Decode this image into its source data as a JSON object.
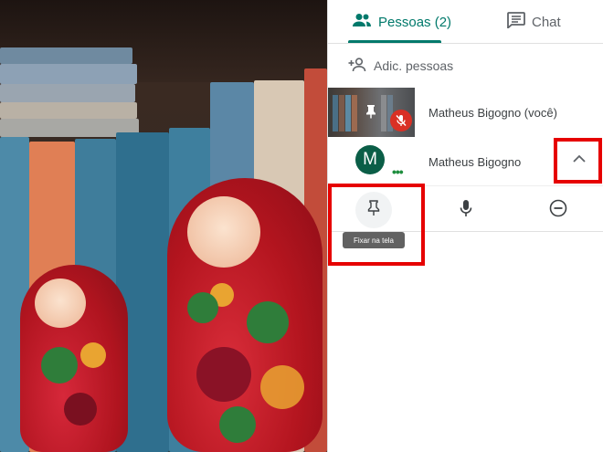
{
  "tabs": {
    "people_label": "Pessoas (2)",
    "chat_label": "Chat"
  },
  "add_people_label": "Adic. pessoas",
  "participants": [
    {
      "name": "Matheus Bigogno (você)",
      "muted": true
    },
    {
      "name": "Matheus Bigogno",
      "avatar_letter": "M",
      "status_dots": "•••"
    }
  ],
  "actions": {
    "pin_tooltip": "Fixar na tela"
  },
  "colors": {
    "accent": "#00796b",
    "mute_red": "#d93025",
    "avatar_green": "#0b5e47",
    "highlight_red": "#e60000"
  },
  "icons": [
    "people-icon",
    "chat-icon",
    "add-person-icon",
    "pin-icon",
    "mic-off-icon",
    "chevron-up-icon",
    "mic-icon",
    "remove-icon"
  ]
}
